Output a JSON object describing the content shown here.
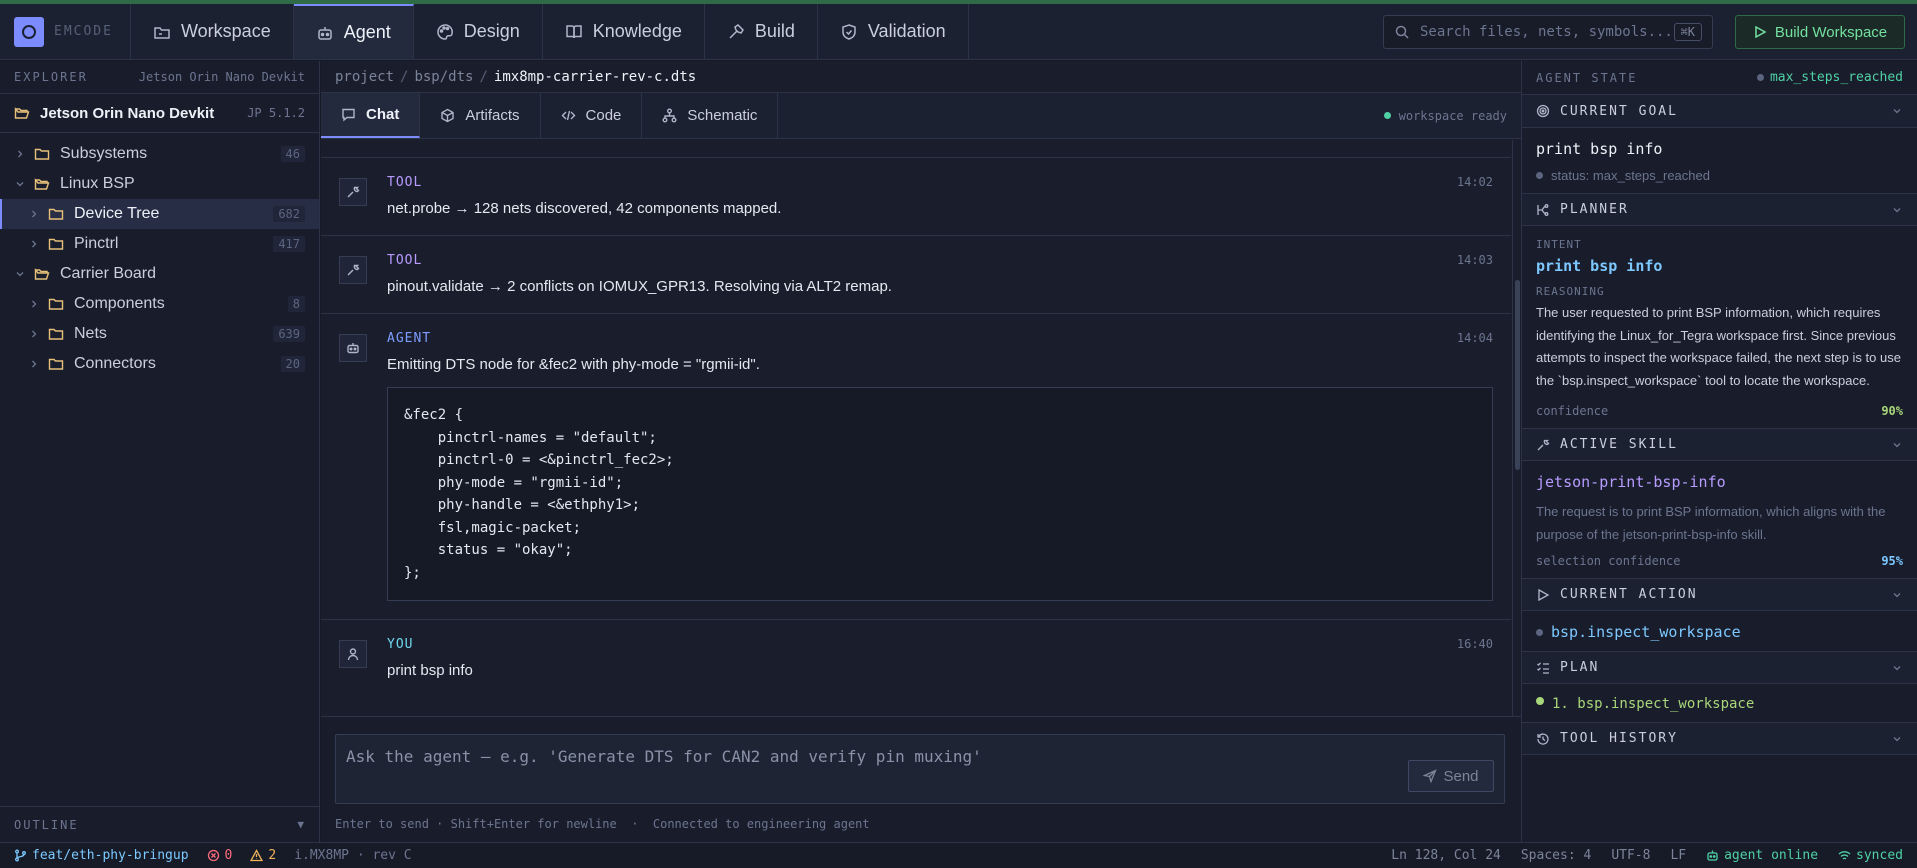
{
  "app": {
    "brand": "EMCODE"
  },
  "nav": {
    "tabs": [
      {
        "label": "Workspace",
        "icon": "workspace-icon"
      },
      {
        "label": "Agent",
        "icon": "robot-icon",
        "active": true
      },
      {
        "label": "Design",
        "icon": "palette-icon"
      },
      {
        "label": "Knowledge",
        "icon": "book-icon"
      },
      {
        "label": "Build",
        "icon": "hammer-icon"
      },
      {
        "label": "Validation",
        "icon": "shield-check-icon"
      }
    ]
  },
  "search": {
    "placeholder": "Search files, nets, symbols...",
    "shortcut": "⌘K"
  },
  "build_button": {
    "label": "Build Workspace"
  },
  "explorer": {
    "title": "EXPLORER",
    "project": "Jetson Orin Nano Devkit",
    "root": {
      "name": "Jetson Orin Nano Devkit",
      "version": "JP 5.1.2"
    },
    "tree": [
      {
        "label": "Subsystems",
        "count": "46",
        "depth": 0,
        "expanded": false
      },
      {
        "label": "Linux BSP",
        "count": "",
        "depth": 0,
        "expanded": true
      },
      {
        "label": "Device Tree",
        "count": "682",
        "depth": 1,
        "expanded": false,
        "selected": true
      },
      {
        "label": "Pinctrl",
        "count": "417",
        "depth": 1,
        "expanded": false
      },
      {
        "label": "Carrier Board",
        "count": "",
        "depth": 0,
        "expanded": true
      },
      {
        "label": "Components",
        "count": "8",
        "depth": 1,
        "expanded": false
      },
      {
        "label": "Nets",
        "count": "639",
        "depth": 1,
        "expanded": false
      },
      {
        "label": "Connectors",
        "count": "20",
        "depth": 1,
        "expanded": false
      }
    ],
    "outline_label": "OUTLINE"
  },
  "breadcrumb": {
    "parts": [
      "project",
      "bsp/dts"
    ],
    "current": "imx8mp-carrier-rev-c.dts"
  },
  "content_tabs": {
    "tabs": [
      {
        "label": "Chat",
        "icon": "chat-icon",
        "active": true
      },
      {
        "label": "Artifacts",
        "icon": "package-icon"
      },
      {
        "label": "Code",
        "icon": "code-icon"
      },
      {
        "label": "Schematic",
        "icon": "schematic-icon"
      }
    ],
    "status": "workspace ready"
  },
  "messages": [
    {
      "role": "TOOL",
      "time": "14:02",
      "text": "net.probe → 128 nets discovered, 42 components mapped."
    },
    {
      "role": "TOOL",
      "time": "14:03",
      "text": "pinout.validate → 2 conflicts on IOMUX_GPR13. Resolving via ALT2 remap."
    },
    {
      "role": "AGENT",
      "time": "14:04",
      "text": "Emitting DTS node for &fec2 with phy-mode = \"rgmii-id\".",
      "code": "&fec2 {\n    pinctrl-names = \"default\";\n    pinctrl-0 = <&pinctrl_fec2>;\n    phy-mode = \"rgmii-id\";\n    phy-handle = <&ethphy1>;\n    fsl,magic-packet;\n    status = \"okay\";\n};"
    },
    {
      "role": "YOU",
      "time": "16:40",
      "text": "print bsp info"
    }
  ],
  "composer": {
    "placeholder": "Ask the agent — e.g. 'Generate DTS for CAN2 and verify pin muxing'",
    "send_label": "Send",
    "hint": "Enter to send · Shift+Enter for newline  ·  Connected to engineering agent"
  },
  "agent_state": {
    "title": "AGENT STATE",
    "status": "max_steps_reached",
    "current_goal": {
      "title": "CURRENT GOAL",
      "goal": "print bsp info",
      "status": "status: max_steps_reached"
    },
    "planner": {
      "title": "PLANNER",
      "intent_label": "INTENT",
      "intent": "print bsp info",
      "reasoning_label": "REASONING",
      "reasoning": "The user requested to print BSP information, which requires identifying the Linux_for_Tegra workspace first. Since previous attempts to inspect the workspace failed, the next step is to use the `bsp.inspect_workspace` tool to locate the workspace.",
      "confidence_label": "confidence",
      "confidence": "90%"
    },
    "active_skill": {
      "title": "ACTIVE SKILL",
      "skill": "jetson-print-bsp-info",
      "description": "The request is to print BSP information, which aligns with the purpose of the jetson-print-bsp-info skill.",
      "confidence_label": "selection confidence",
      "confidence": "95%"
    },
    "current_action": {
      "title": "CURRENT ACTION",
      "action": "bsp.inspect_workspace"
    },
    "plan": {
      "title": "PLAN",
      "steps": [
        "1. bsp.inspect_workspace"
      ]
    },
    "tool_history": {
      "title": "TOOL HISTORY"
    }
  },
  "statusbar": {
    "branch": "feat/eth-phy-bringup",
    "errors": "0",
    "warnings": "2",
    "target": "i.MX8MP · rev C",
    "cursor": "Ln 128, Col 24",
    "spaces": "Spaces: 4",
    "encoding": "UTF-8",
    "eol": "LF",
    "agent": "agent online",
    "sync": "synced"
  },
  "colors": {
    "accent": "#7c8cff",
    "success": "#4fd1a5",
    "error": "#ff6b7d",
    "warning": "#f0b35a"
  }
}
